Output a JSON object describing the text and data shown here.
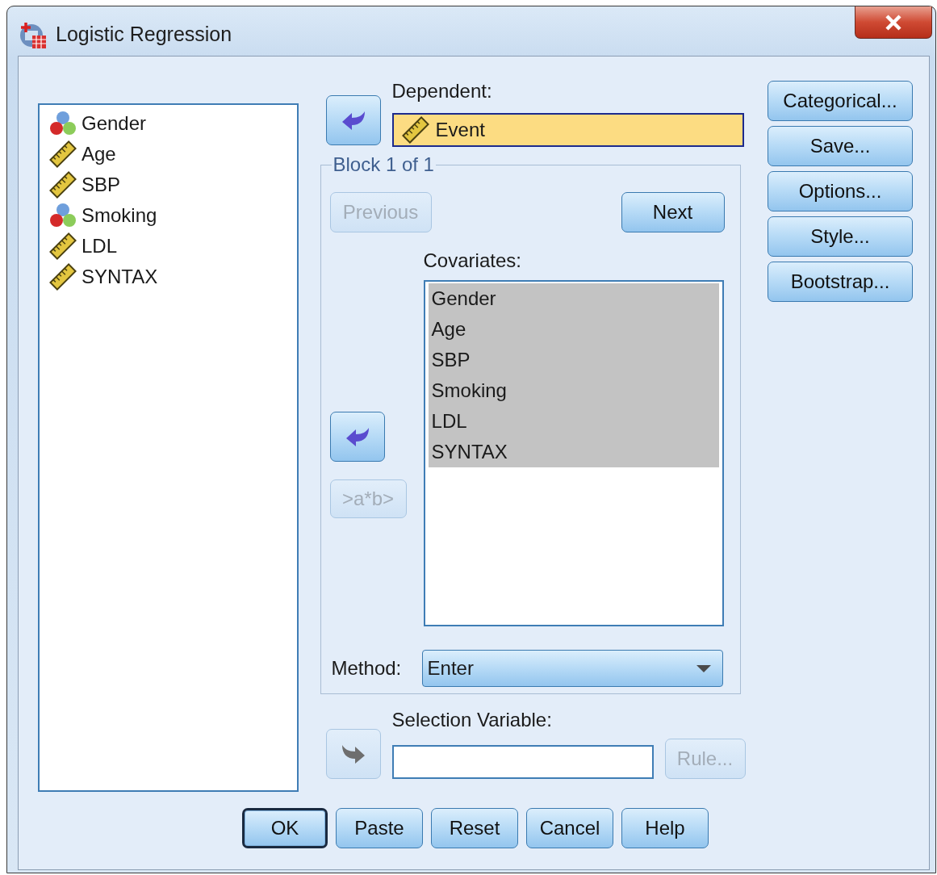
{
  "window": {
    "title": "Logistic Regression"
  },
  "variables": [
    {
      "name": "Gender",
      "kind": "nominal"
    },
    {
      "name": "Age",
      "kind": "scale"
    },
    {
      "name": "SBP",
      "kind": "scale"
    },
    {
      "name": "Smoking",
      "kind": "nominal"
    },
    {
      "name": "LDL",
      "kind": "scale"
    },
    {
      "name": "SYNTAX",
      "kind": "scale"
    }
  ],
  "dependent": {
    "label": "Dependent:",
    "arrow": {
      "kind": "left",
      "disabled": false
    },
    "variable": {
      "name": "Event",
      "kind": "scale"
    }
  },
  "block": {
    "title": "Block 1 of 1",
    "previous": {
      "label": "Previous",
      "disabled": true
    },
    "next": {
      "label": "Next",
      "disabled": false
    },
    "covariates_label": "Covariates:",
    "covariates": [
      {
        "name": "Gender",
        "selected": true
      },
      {
        "name": "Age",
        "selected": true
      },
      {
        "name": "SBP",
        "selected": true
      },
      {
        "name": "Smoking",
        "selected": true
      },
      {
        "name": "LDL",
        "selected": true
      },
      {
        "name": "SYNTAX",
        "selected": true
      }
    ],
    "arrow": {
      "kind": "left",
      "disabled": false
    },
    "interaction": {
      "label": ">a*b>",
      "disabled": true
    },
    "method": {
      "label": "Method:",
      "value": "Enter"
    }
  },
  "selection": {
    "label": "Selection Variable:",
    "arrow": {
      "kind": "right",
      "disabled": true
    },
    "rule": {
      "label": "Rule...",
      "disabled": true
    }
  },
  "side_buttons": [
    {
      "label": "Categorical..."
    },
    {
      "label": "Save..."
    },
    {
      "label": "Options..."
    },
    {
      "label": "Style..."
    },
    {
      "label": "Bootstrap..."
    }
  ],
  "buttons": [
    {
      "label": "OK",
      "default": true
    },
    {
      "label": "Paste",
      "default": false
    },
    {
      "label": "Reset",
      "default": false
    },
    {
      "label": "Cancel",
      "default": false
    },
    {
      "label": "Help",
      "default": false
    }
  ]
}
